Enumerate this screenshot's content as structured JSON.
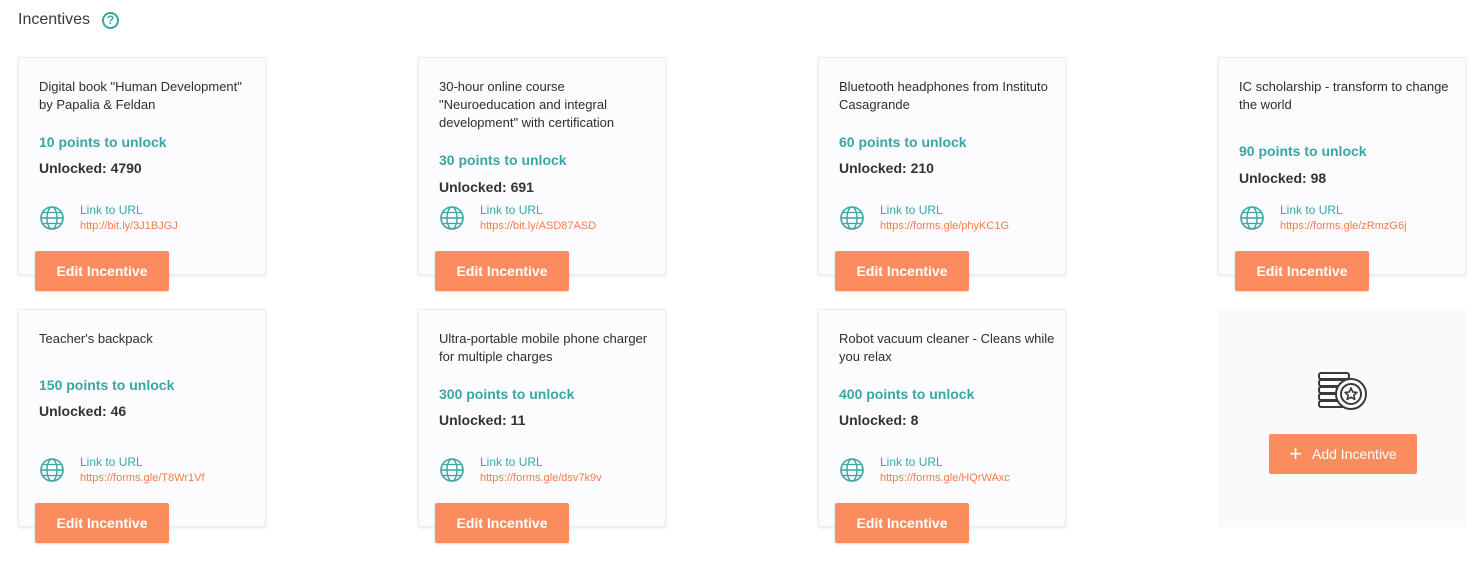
{
  "header": {
    "title": "Incentives",
    "help_glyph": "?"
  },
  "cards": [
    {
      "name": "Digital book \"Human Development\" by Papalia & Feldan",
      "points": "10 points to unlock",
      "unlocked": "Unlocked: 4790",
      "link_label": "Link to URL",
      "url": "http://bit.ly/3J1BJGJ",
      "button": "Edit Incentive"
    },
    {
      "name": "30-hour online course \"Neuroeducation and integral development\" with certification",
      "points": "30 points to unlock",
      "unlocked": "Unlocked: 691",
      "link_label": "Link to URL",
      "url": "https://bit.ly/ASD87ASD",
      "button": "Edit Incentive"
    },
    {
      "name": "Bluetooth headphones from Instituto Casagrande",
      "points": "60 points to unlock",
      "unlocked": "Unlocked: 210",
      "link_label": "Link to URL",
      "url": "https://forms.gle/phyKC1G",
      "button": "Edit Incentive"
    },
    {
      "name": "IC scholarship - transform to change the world",
      "points": "90 points to unlock",
      "unlocked": "Unlocked: 98",
      "link_label": "Link to URL",
      "url": "https://forms.gle/zRmzG6j",
      "button": "Edit Incentive"
    },
    {
      "name": "Teacher's backpack",
      "points": "150 points to unlock",
      "unlocked": "Unlocked: 46",
      "link_label": "Link to URL",
      "url": "https://forms.gle/T8Wr1Vf",
      "button": "Edit Incentive"
    },
    {
      "name": "Ultra-portable mobile phone charger for multiple charges",
      "points": "300 points to unlock",
      "unlocked": "Unlocked: 11",
      "link_label": "Link to URL",
      "url": "https://forms.gle/dsv7k9v",
      "button": "Edit Incentive"
    },
    {
      "name": "Robot vacuum cleaner - Cleans while you relax",
      "points": "400 points to unlock",
      "unlocked": "Unlocked: 8",
      "link_label": "Link to URL",
      "url": "https://forms.gle/HQrWAxc",
      "button": "Edit Incentive"
    }
  ],
  "add_card": {
    "icon": "coins-stack-icon",
    "button": "Add Incentive",
    "button_glyph": "+"
  },
  "colors": {
    "accent": "#3aa6a4",
    "button": "#fa8c5e",
    "url": "#f47e4c"
  }
}
